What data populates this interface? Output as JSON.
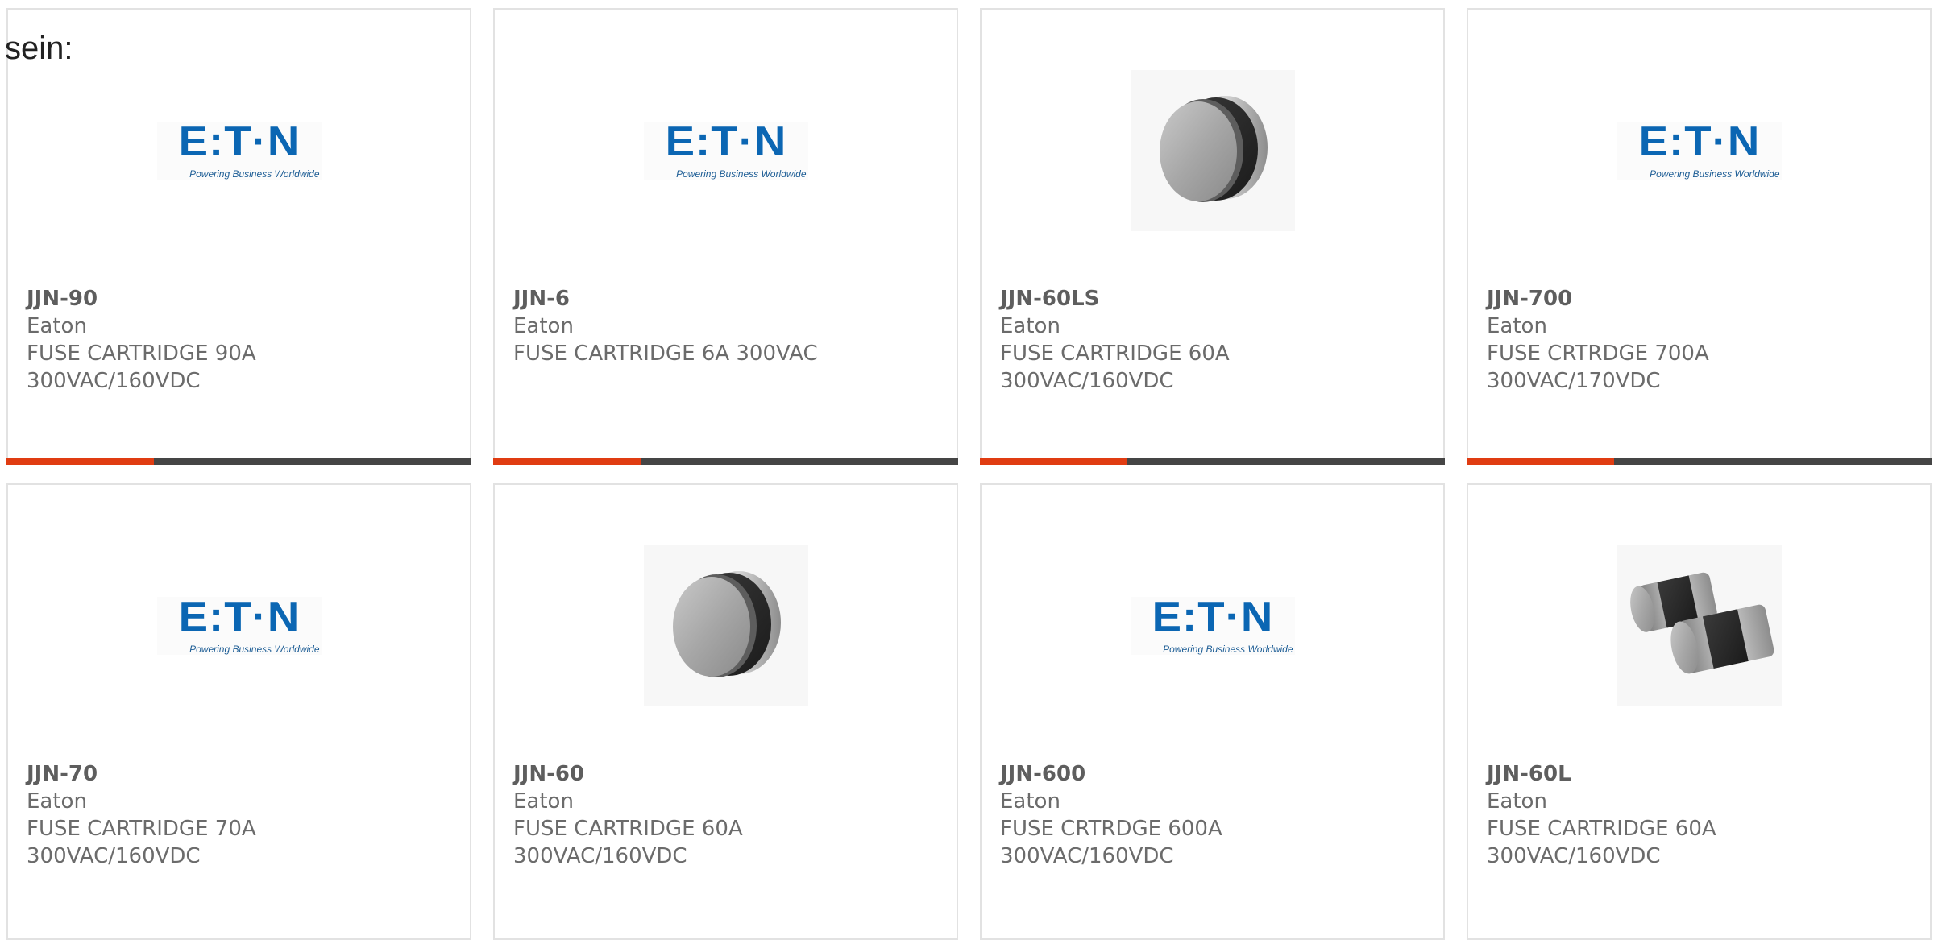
{
  "lead_text": "sein:",
  "brand": {
    "logo_word": "E:T·N",
    "logo_tagline": "Powering Business Worldwide",
    "logo_color": "#0b66b3",
    "accent_color": "#e03c12",
    "bar_color": "#454545"
  },
  "products": [
    {
      "part_number": "JJN-90",
      "manufacturer": "Eaton",
      "description": "FUSE CARTRIDGE 90A 300VAC/160VDC",
      "image": "eaton-logo",
      "has_bar": true
    },
    {
      "part_number": "JJN-6",
      "manufacturer": "Eaton",
      "description": "FUSE CARTRIDGE 6A 300VAC",
      "image": "eaton-logo",
      "has_bar": true
    },
    {
      "part_number": "JJN-60LS",
      "manufacturer": "Eaton",
      "description": "FUSE CARTRIDGE 60A 300VAC/160VDC",
      "image": "fuse-single",
      "has_bar": true
    },
    {
      "part_number": "JJN-700",
      "manufacturer": "Eaton",
      "description": "FUSE CRTRDGE 700A 300VAC/170VDC",
      "image": "eaton-logo",
      "has_bar": true
    },
    {
      "part_number": "JJN-70",
      "manufacturer": "Eaton",
      "description": "FUSE CARTRIDGE 70A 300VAC/160VDC",
      "image": "eaton-logo",
      "has_bar": false
    },
    {
      "part_number": "JJN-60",
      "manufacturer": "Eaton",
      "description": "FUSE CARTRIDGE 60A 300VAC/160VDC",
      "image": "fuse-single",
      "has_bar": false
    },
    {
      "part_number": "JJN-600",
      "manufacturer": "Eaton",
      "description": "FUSE CRTRDGE 600A 300VAC/160VDC",
      "image": "eaton-logo",
      "has_bar": false
    },
    {
      "part_number": "JJN-60L",
      "manufacturer": "Eaton",
      "description": "FUSE CARTRIDGE 60A 300VAC/160VDC",
      "image": "fuse-pair",
      "has_bar": false
    }
  ]
}
